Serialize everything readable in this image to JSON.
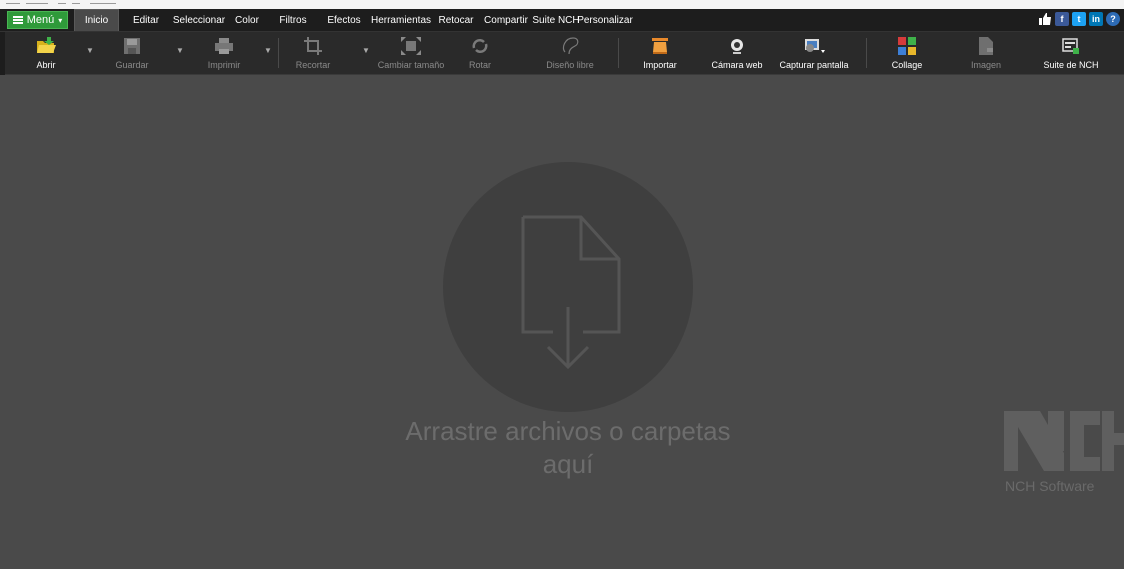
{
  "menu": {
    "label": "Menú"
  },
  "tabs": [
    {
      "label": "Inicio",
      "active": true
    },
    {
      "label": "Editar"
    },
    {
      "label": "Seleccionar"
    },
    {
      "label": "Color"
    },
    {
      "label": "Filtros"
    },
    {
      "label": "Efectos"
    },
    {
      "label": "Herramientas"
    },
    {
      "label": "Retocar"
    },
    {
      "label": "Compartir"
    },
    {
      "label": "Suite NCH"
    },
    {
      "label": "Personalizar"
    }
  ],
  "social": {
    "like_icon": "thumbs-up-icon",
    "facebook": "f",
    "twitter": "t",
    "linkedin": "in",
    "help": "?"
  },
  "toolbar": {
    "open": "Abrir",
    "save": "Guardar",
    "print": "Imprimir",
    "crop": "Recortar",
    "resize": "Cambiar tamaño",
    "rotate": "Rotar",
    "freeform": "Diseño libre",
    "import": "Importar",
    "webcam": "Cámara web",
    "screenshot": "Capturar pantalla",
    "collage": "Collage",
    "image": "Imagen",
    "suite": "Suite de NCH"
  },
  "drop_area": {
    "line1": "Arrastre archivos o carpetas",
    "line2": "aquí"
  },
  "brand": {
    "logo": "NCH",
    "name": "NCH Software"
  },
  "colors": {
    "menu_green": "#2f9a3a",
    "background": "#4a4a4a",
    "toolbar": "#2a2a2a",
    "menubar": "#1d1d1d"
  }
}
